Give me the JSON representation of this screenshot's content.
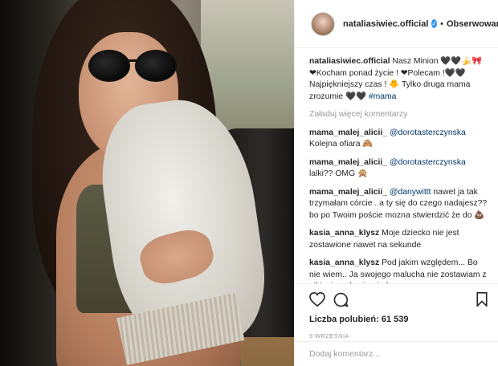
{
  "post": {
    "username": "nataliasiwiec.official",
    "verified_icon": "verified-check-icon",
    "separator": "•",
    "follow_label": "Obserwowanie"
  },
  "caption": {
    "user": "nataliasiwiec.official",
    "text_1": "Nasz Minion 🖤🖤🍌🎀",
    "text_2": "❤Kocham ponad życie ! ❤Polecam !🖤🖤",
    "text_3": "Najpiękniejszy czas ! 🐥 Tylko druga mama zrozumie 🖤🖤",
    "hashtag": "#mama"
  },
  "load_more_label": "Załaduj więcej komentarzy",
  "comments": [
    {
      "user": "mama_malej_alicii_",
      "mention": "@dorotasterczynska",
      "text": "Kolejna ofiara 🙈"
    },
    {
      "user": "mama_malej_alicii_",
      "mention": "@dorotasterczynska",
      "text": "lalki?? OMG 🙊"
    },
    {
      "user": "mama_malej_alicii_",
      "mention": "@danywittt",
      "text": "nawet ja tak trzymałam córcie . a ty się do czego nadajesz?? bo po Twoim poście mozna stwierdzić że do 💩"
    },
    {
      "user": "kasia_anna_klysz",
      "mention": "",
      "text": "Moje dziecko nie jest zostawione nawet na sekunde"
    },
    {
      "user": "kasia_anna_klysz",
      "mention": "",
      "text": "Pod jakim względem... Bo nie wiem.. Ja swojego malucha nie zostawiam z nikim i po drugie nigdy"
    }
  ],
  "likes_label": "Liczba polubień: 61 539",
  "date_label": "9 WRZEŚNIA",
  "add_comment_placeholder": "Dodaj komentarz...",
  "colors": {
    "link": "#003569",
    "muted": "#999999",
    "verified": "#3897f0",
    "border": "#efefef"
  }
}
